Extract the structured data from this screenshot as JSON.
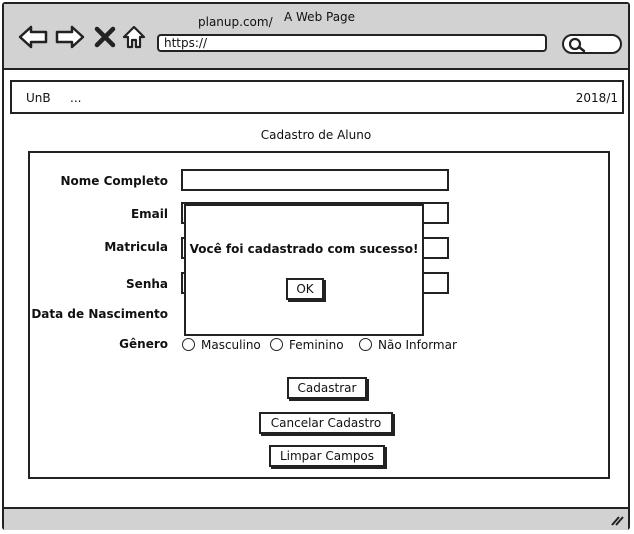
{
  "browser": {
    "url_tag": "planup.com/",
    "window_title": "A Web Page",
    "address": "https://",
    "icons": [
      "back-arrow-icon",
      "forward-arrow-icon",
      "close-x-icon",
      "home-icon",
      "search-icon"
    ]
  },
  "topbar": {
    "left": "UnB",
    "dots": "...",
    "right": "2018/1"
  },
  "page": {
    "title": "Cadastro de Aluno"
  },
  "form": {
    "labels": {
      "nome": "Nome Completo",
      "email": "Email",
      "matricula": "Matricula",
      "senha": "Senha",
      "nascimento": "Data de Nascimento",
      "genero": "Gênero"
    },
    "genero_options": [
      "Masculino",
      "Feminino",
      "Não Informar"
    ],
    "buttons": {
      "cadastrar": "Cadastrar",
      "cancelar": "Cancelar Cadastro",
      "limpar": "Limpar Campos"
    }
  },
  "modal": {
    "message": "Você foi cadastrado com sucesso!",
    "ok": "OK"
  },
  "colors": {
    "chrome": "#d2d2d2",
    "stroke": "#222222"
  }
}
